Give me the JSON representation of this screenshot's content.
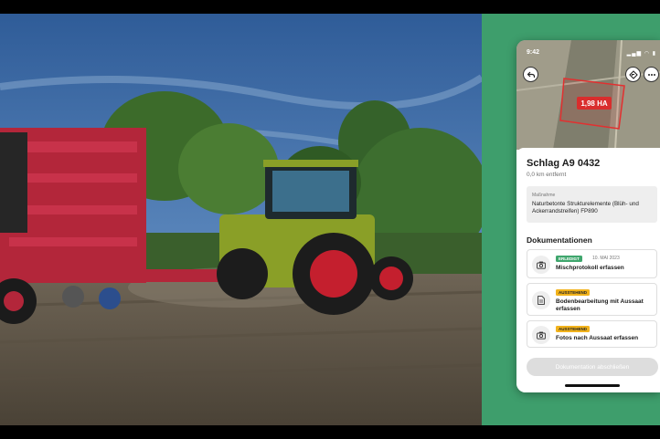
{
  "status_bar": {
    "time": "9:42",
    "icons": "▂▄▆ ◠ ▮"
  },
  "map": {
    "field_area": "1,98 HA",
    "back_icon": "arrow-back-icon",
    "navigate_icon": "navigation-diamond-icon",
    "more_icon": "more-dots-icon"
  },
  "field": {
    "title": "Schlag A9 0432",
    "distance": "0,0 km entfernt"
  },
  "measure": {
    "label": "Maßnahme",
    "value": "Naturbetonte Strukturelemente (Blüh- und Ackerrandstreifen) FP890"
  },
  "documentation": {
    "heading": "Dokumentationen",
    "items": [
      {
        "status": "ERLEDIGT",
        "status_type": "done",
        "date": "10. MAI 2023",
        "label": "Mischprotokoll erfassen",
        "icon": "camera-icon"
      },
      {
        "status": "AUSSTEHEND",
        "status_type": "pending",
        "date": "",
        "label": "Bodenbearbeitung mit Aussaat erfassen",
        "icon": "document-icon"
      },
      {
        "status": "AUSSTEHEND",
        "status_type": "pending",
        "date": "",
        "label": "Fotos nach Aussaat erfassen",
        "icon": "camera-icon"
      }
    ]
  },
  "submit": {
    "label": "Dokumentation abschließen"
  },
  "colors": {
    "accent_green": "#3e9e6c",
    "field_red": "#d92d2d",
    "done_green": "#3fa66d",
    "pending_yellow": "#f2b31c"
  }
}
